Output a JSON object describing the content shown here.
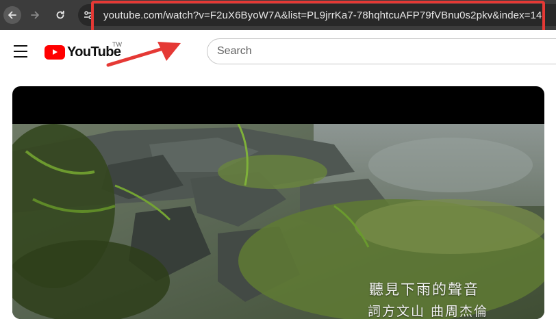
{
  "browser": {
    "url": "youtube.com/watch?v=F2uX6ByoW7A&list=PL9jrrKa7-78hqhtcuAFP79fVBnu0s2pkv&index=14",
    "highlight_color": "#e53935"
  },
  "header": {
    "logo_text": "YouTube",
    "region_code": "TW",
    "search_placeholder": "Search"
  },
  "video": {
    "subtitle_line1": "聽見下雨的聲音",
    "subtitle_line2": "詞方文山 曲周杰倫"
  },
  "colors": {
    "youtube_red": "#ff0000",
    "chrome_bg": "#3c3c3c",
    "annotation": "#e53935"
  }
}
